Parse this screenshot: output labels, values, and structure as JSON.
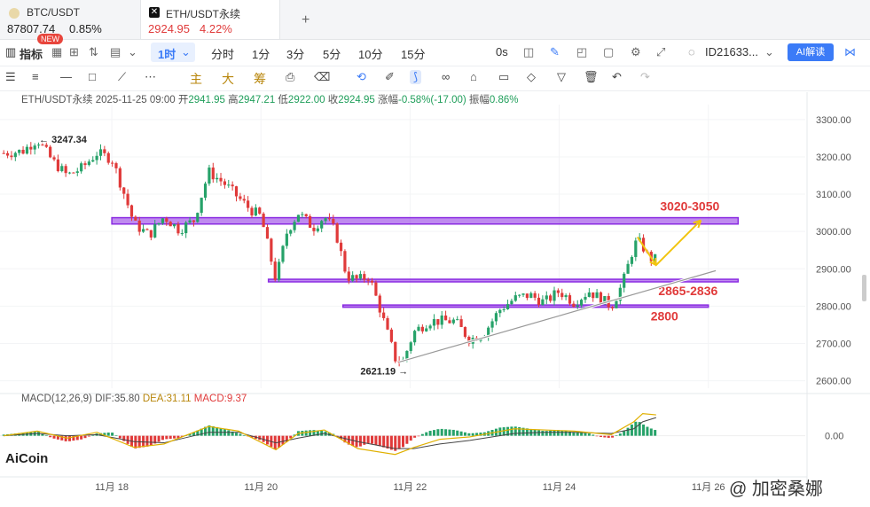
{
  "tabs": [
    {
      "symbol": "BTC/USDT",
      "price": "87807.74",
      "change": "0.85%",
      "badge": "NEW"
    },
    {
      "symbol": "ETH/USDT永续",
      "price": "2924.95",
      "change": "4.22%"
    }
  ],
  "toolbar": {
    "indicators_label": "指标",
    "interval_active": "1时",
    "intervals": [
      "分时",
      "1分",
      "3分",
      "5分",
      "10分",
      "15分"
    ],
    "countdown": "0s",
    "user_id": "ID21633...",
    "ai_label": "AI解读"
  },
  "drawing_tools": {
    "main_label": "主",
    "big_label": "大",
    "chip_label": "筹"
  },
  "ohlc": {
    "symbol": "ETH/USDT永续",
    "datetime": "2025-11-25 09:00",
    "open_label": "开",
    "open": "2941.95",
    "high_label": "高",
    "high": "2947.21",
    "low_label": "低",
    "low": "2922.00",
    "close_label": "收",
    "close": "2924.95",
    "chg_label": "涨幅",
    "chg": "-0.58%(-17.00)",
    "amp_label": "振幅",
    "amp": "0.86%"
  },
  "macd": {
    "label": "MACD(12,26,9)",
    "dif_label": "DIF:",
    "dif": "35.80",
    "dea_label": "DEA:",
    "dea": "31.11",
    "macd_label": "MACD:",
    "macd": "9.37",
    "zero_tick": "0.00"
  },
  "colors": {
    "up": "#26a269",
    "down": "#e03a3a",
    "zone": "#8a2be2",
    "dif_line": "#e0b000",
    "dea_line": "#444444"
  },
  "chart_data": {
    "type": "candlestick",
    "y_ticks": [
      "3300.00",
      "3200.00",
      "3100.00",
      "3000.00",
      "2900.00",
      "2800.00",
      "2700.00",
      "2600.00"
    ],
    "ylim": [
      2580,
      3340
    ],
    "x_ticks": [
      "11月 18",
      "11月 20",
      "11月 22",
      "11月 24",
      "11月 26"
    ],
    "x_tick_values": [
      18,
      20,
      22,
      24,
      26
    ],
    "xlim": [
      16.5,
      27.3
    ],
    "close_path": [
      [
        16.55,
        3210
      ],
      [
        16.8,
        3215
      ],
      [
        17.0,
        3247
      ],
      [
        17.2,
        3190
      ],
      [
        17.4,
        3150
      ],
      [
        17.6,
        3170
      ],
      [
        17.8,
        3210
      ],
      [
        18.0,
        3195
      ],
      [
        18.15,
        3110
      ],
      [
        18.3,
        3020
      ],
      [
        18.5,
        2990
      ],
      [
        18.7,
        3040
      ],
      [
        18.9,
        3005
      ],
      [
        19.1,
        3030
      ],
      [
        19.3,
        3160
      ],
      [
        19.5,
        3130
      ],
      [
        19.7,
        3090
      ],
      [
        19.85,
        3060
      ],
      [
        20.0,
        3040
      ],
      [
        20.2,
        2870
      ],
      [
        20.35,
        3000
      ],
      [
        20.5,
        3050
      ],
      [
        20.7,
        3010
      ],
      [
        20.85,
        3040
      ],
      [
        21.0,
        3000
      ],
      [
        21.15,
        2880
      ],
      [
        21.3,
        2870
      ],
      [
        21.45,
        2880
      ],
      [
        21.6,
        2790
      ],
      [
        21.8,
        2660
      ],
      [
        21.9,
        2650
      ],
      [
        22.05,
        2730
      ],
      [
        22.25,
        2760
      ],
      [
        22.4,
        2760
      ],
      [
        22.6,
        2760
      ],
      [
        22.8,
        2710
      ],
      [
        23.0,
        2730
      ],
      [
        23.2,
        2790
      ],
      [
        23.4,
        2820
      ],
      [
        23.6,
        2830
      ],
      [
        23.8,
        2810
      ],
      [
        24.0,
        2840
      ],
      [
        24.2,
        2810
      ],
      [
        24.4,
        2840
      ],
      [
        24.55,
        2820
      ],
      [
        24.7,
        2800
      ],
      [
        24.85,
        2860
      ],
      [
        25.0,
        2960
      ],
      [
        25.05,
        2975
      ],
      [
        25.12,
        2960
      ],
      [
        25.2,
        2930
      ],
      [
        25.3,
        2925
      ]
    ],
    "low_marker": {
      "x": 22.0,
      "y": 2621.19,
      "label": "2621.19"
    },
    "high_marker": {
      "x": 17.0,
      "y": 3247.34,
      "label": "3247.34"
    },
    "zones": [
      {
        "low": 3020,
        "high": 3037,
        "x_start": 18.0,
        "x_end": 26.4,
        "label": "3020-3050"
      },
      {
        "low": 2865,
        "high": 2872,
        "x_start": 20.1,
        "x_end": 26.4,
        "label": "2865-2836"
      },
      {
        "low": 2797,
        "high": 2803,
        "x_start": 21.1,
        "x_end": 26.0,
        "label": "2800"
      }
    ],
    "trendline": [
      [
        21.85,
        2650
      ],
      [
        26.1,
        2895
      ]
    ],
    "projection": [
      [
        25.05,
        2985
      ],
      [
        25.3,
        2910
      ],
      [
        25.9,
        3030
      ]
    ],
    "macd_histogram": [
      [
        16.55,
        2
      ],
      [
        16.8,
        5
      ],
      [
        17.0,
        8
      ],
      [
        17.2,
        -4
      ],
      [
        17.4,
        -10
      ],
      [
        17.6,
        -6
      ],
      [
        17.8,
        4
      ],
      [
        18.0,
        6
      ],
      [
        18.15,
        -8
      ],
      [
        18.3,
        -22
      ],
      [
        18.5,
        -18
      ],
      [
        18.7,
        -6
      ],
      [
        18.9,
        -4
      ],
      [
        19.1,
        6
      ],
      [
        19.3,
        18
      ],
      [
        19.5,
        12
      ],
      [
        19.7,
        4
      ],
      [
        19.85,
        -2
      ],
      [
        20.0,
        -8
      ],
      [
        20.2,
        -24
      ],
      [
        20.35,
        -10
      ],
      [
        20.5,
        8
      ],
      [
        20.7,
        10
      ],
      [
        20.85,
        8
      ],
      [
        21.0,
        2
      ],
      [
        21.15,
        -14
      ],
      [
        21.3,
        -20
      ],
      [
        21.45,
        -12
      ],
      [
        21.6,
        -18
      ],
      [
        21.8,
        -26
      ],
      [
        21.9,
        -20
      ],
      [
        22.05,
        -4
      ],
      [
        22.25,
        8
      ],
      [
        22.4,
        12
      ],
      [
        22.6,
        10
      ],
      [
        22.8,
        4
      ],
      [
        23.0,
        6
      ],
      [
        23.2,
        14
      ],
      [
        23.4,
        16
      ],
      [
        23.6,
        12
      ],
      [
        23.8,
        8
      ],
      [
        24.0,
        10
      ],
      [
        24.2,
        6
      ],
      [
        24.4,
        4
      ],
      [
        24.55,
        -2
      ],
      [
        24.7,
        -4
      ],
      [
        24.85,
        6
      ],
      [
        25.0,
        22
      ],
      [
        25.05,
        26
      ],
      [
        25.12,
        20
      ],
      [
        25.2,
        14
      ],
      [
        25.3,
        9.37
      ]
    ],
    "dif": [
      [
        16.55,
        0
      ],
      [
        17.0,
        8
      ],
      [
        17.4,
        -4
      ],
      [
        17.8,
        6
      ],
      [
        18.3,
        -20
      ],
      [
        18.7,
        -14
      ],
      [
        19.3,
        16
      ],
      [
        19.7,
        8
      ],
      [
        20.2,
        -24
      ],
      [
        20.5,
        4
      ],
      [
        20.85,
        10
      ],
      [
        21.3,
        -22
      ],
      [
        21.8,
        -32
      ],
      [
        22.05,
        -20
      ],
      [
        22.4,
        -6
      ],
      [
        22.8,
        -2
      ],
      [
        23.4,
        12
      ],
      [
        23.8,
        10
      ],
      [
        24.2,
        8
      ],
      [
        24.7,
        2
      ],
      [
        25.0,
        24
      ],
      [
        25.12,
        38
      ],
      [
        25.3,
        35.8
      ]
    ],
    "dea": [
      [
        16.55,
        0
      ],
      [
        17.0,
        4
      ],
      [
        17.4,
        0
      ],
      [
        17.8,
        2
      ],
      [
        18.3,
        -10
      ],
      [
        18.7,
        -12
      ],
      [
        19.3,
        6
      ],
      [
        19.7,
        6
      ],
      [
        20.2,
        -12
      ],
      [
        20.5,
        -4
      ],
      [
        20.85,
        4
      ],
      [
        21.3,
        -10
      ],
      [
        21.8,
        -22
      ],
      [
        22.05,
        -22
      ],
      [
        22.4,
        -14
      ],
      [
        22.8,
        -8
      ],
      [
        23.4,
        4
      ],
      [
        23.8,
        6
      ],
      [
        24.2,
        6
      ],
      [
        24.7,
        4
      ],
      [
        25.0,
        12
      ],
      [
        25.12,
        24
      ],
      [
        25.3,
        31.11
      ]
    ],
    "macd_ylim": [
      -40,
      45
    ]
  },
  "branding": {
    "logo": "AiCoin",
    "watermark": "@ 加密桑娜"
  }
}
